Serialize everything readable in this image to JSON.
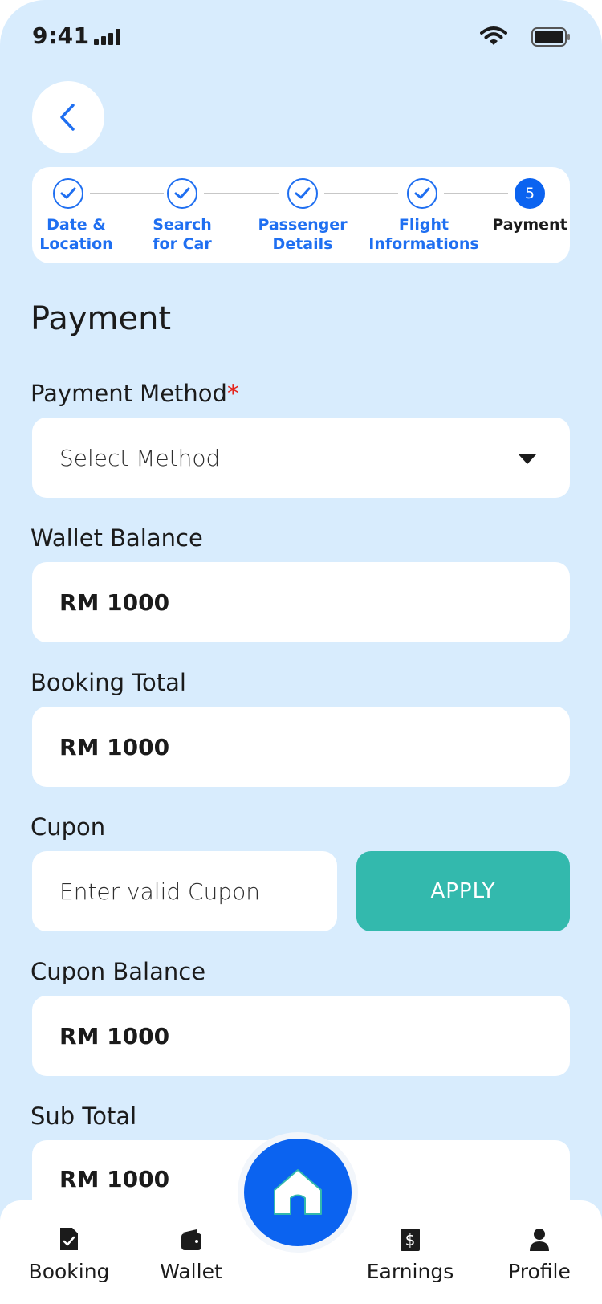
{
  "status_bar": {
    "time": "9:41"
  },
  "stepper": {
    "steps": [
      {
        "label_line1": "Date &",
        "label_line2": "Location",
        "state": "done"
      },
      {
        "label_line1": "Search",
        "label_line2": "for Car",
        "state": "done"
      },
      {
        "label_line1": "Passenger",
        "label_line2": "Details",
        "state": "done"
      },
      {
        "label_line1": "Flight",
        "label_line2": "Informations",
        "state": "done"
      },
      {
        "label_line1": "Payment",
        "label_line2": "",
        "state": "active",
        "number": "5"
      }
    ]
  },
  "page": {
    "title": "Payment"
  },
  "payment_method": {
    "label": "Payment Method",
    "required_mark": "*",
    "placeholder": "Select Method"
  },
  "wallet_balance": {
    "label": "Wallet Balance",
    "value": "RM 1000"
  },
  "booking_total": {
    "label": "Booking Total",
    "value": "RM 1000"
  },
  "cupon": {
    "label": "Cupon",
    "placeholder": "Enter valid Cupon",
    "apply_label": "APPLY"
  },
  "cupon_balance": {
    "label": "Cupon Balance",
    "value": "RM 1000"
  },
  "sub_total": {
    "label": "Sub Total",
    "value": "RM 1000"
  },
  "bottom_nav": {
    "items": [
      {
        "label": "Booking",
        "icon": "booking-doc-icon"
      },
      {
        "label": "Wallet",
        "icon": "wallet-icon"
      },
      {
        "label": "Earnings",
        "icon": "dollar-icon"
      },
      {
        "label": "Profile",
        "icon": "user-icon"
      }
    ],
    "center_icon": "home-icon"
  },
  "colors": {
    "accent": "#0b63f0",
    "apply": "#33b9ad",
    "background": "#d8ecfd",
    "required": "#e5231b"
  }
}
